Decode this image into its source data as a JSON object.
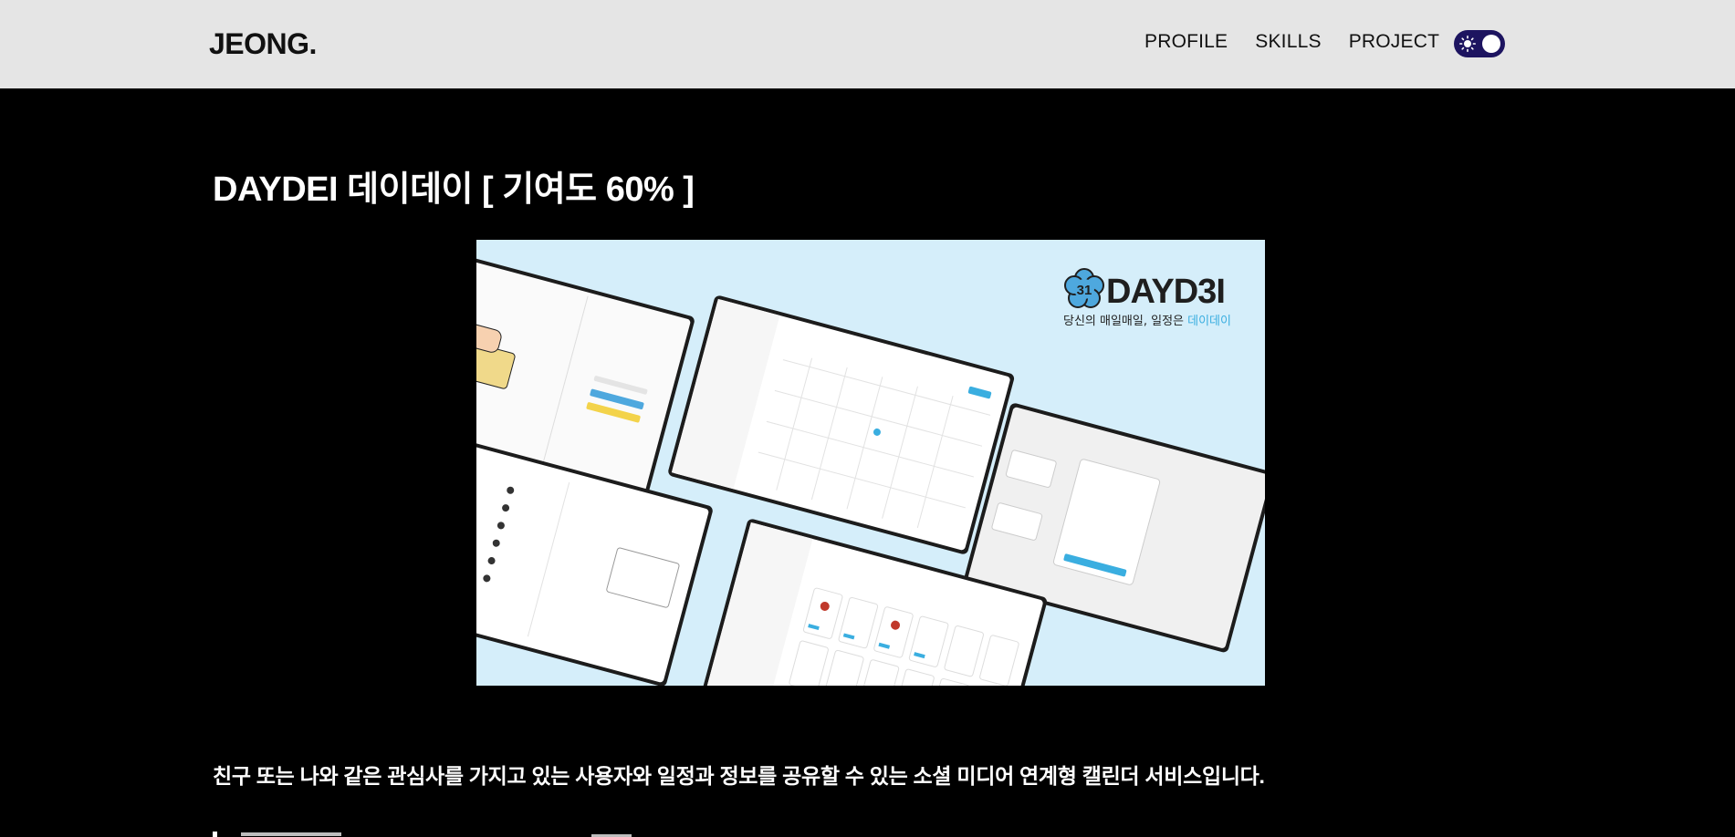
{
  "header": {
    "logo": "JEONG.",
    "nav": [
      "PROFILE",
      "SKILLS",
      "PROJECT"
    ],
    "theme_toggle": {
      "state": "light",
      "icon": "sun-icon"
    },
    "colors": {
      "background": "#e5e5e5",
      "toggle": "#1d1460"
    }
  },
  "project": {
    "title": "DAYDEI 데이데이 [ 기여도 60% ]",
    "image": {
      "brand": "DAYD3I",
      "badge": "31",
      "tagline_prefix": "당신의 매일매일, 일정은",
      "tagline_highlight": "데이데이",
      "background_color": "#d5eefa",
      "accent_color": "#3aaee0"
    },
    "description": "친구 또는 나와 같은 관심사를 가지고 있는 사용자와 일정과 정보를 공유할 수 있는 소셜 미디어 연계형 캘린더 서비스입니다."
  }
}
